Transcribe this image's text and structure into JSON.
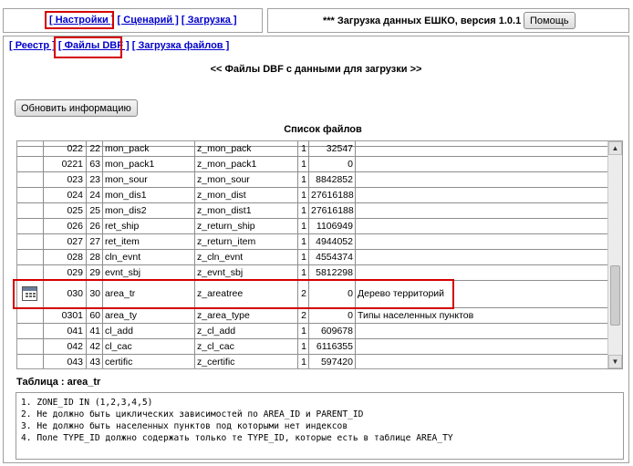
{
  "topnav": {
    "settings": "[ Настройки ]",
    "scenario": "[ Сценарий ]",
    "upload": "[ Загрузка ]"
  },
  "header": {
    "title": "*** Загрузка данных ЕШКО, версия 1.0.1 ***",
    "help_label": "Помощь"
  },
  "subtabs": {
    "registry": "[ Реестр ]",
    "dbf_files": "[ Файлы DBF ]",
    "file_upload": "[ Загрузка файлов ]"
  },
  "heading": "<< Файлы DBF с данными для загрузки >>",
  "refresh_label": "Обновить информацию",
  "list_caption": "Список файлов",
  "grid": {
    "rows": [
      {
        "code": "022",
        "num": "22",
        "file": "mon_pack",
        "table": "z_mon_pack",
        "type": "1",
        "count": "32547",
        "descr": ""
      },
      {
        "code": "0221",
        "num": "63",
        "file": "mon_pack1",
        "table": "z_mon_pack1",
        "type": "1",
        "count": "0",
        "descr": ""
      },
      {
        "code": "023",
        "num": "23",
        "file": "mon_sour",
        "table": "z_mon_sour",
        "type": "1",
        "count": "8842852",
        "descr": ""
      },
      {
        "code": "024",
        "num": "24",
        "file": "mon_dis1",
        "table": "z_mon_dist",
        "type": "1",
        "count": "27616188",
        "descr": ""
      },
      {
        "code": "025",
        "num": "25",
        "file": "mon_dis2",
        "table": "z_mon_dist1",
        "type": "1",
        "count": "27616188",
        "descr": ""
      },
      {
        "code": "026",
        "num": "26",
        "file": "ret_ship",
        "table": "z_return_ship",
        "type": "1",
        "count": "1106949",
        "descr": ""
      },
      {
        "code": "027",
        "num": "27",
        "file": "ret_item",
        "table": "z_return_item",
        "type": "1",
        "count": "4944052",
        "descr": ""
      },
      {
        "code": "028",
        "num": "28",
        "file": "cln_evnt",
        "table": "z_cln_evnt",
        "type": "1",
        "count": "4554374",
        "descr": ""
      },
      {
        "code": "029",
        "num": "29",
        "file": "evnt_sbj",
        "table": "z_evnt_sbj",
        "type": "1",
        "count": "5812298",
        "descr": ""
      },
      {
        "code": "030",
        "num": "30",
        "file": "area_tr",
        "table": "z_areatree",
        "type": "2",
        "count": "0",
        "descr": "Дерево территорий",
        "selected": true
      },
      {
        "code": "0301",
        "num": "60",
        "file": "area_ty",
        "table": "z_area_type",
        "type": "2",
        "count": "0",
        "descr": "Типы населенных пунктов"
      },
      {
        "code": "041",
        "num": "41",
        "file": "cl_add",
        "table": "z_cl_add",
        "type": "1",
        "count": "609678",
        "descr": ""
      },
      {
        "code": "042",
        "num": "42",
        "file": "cl_cac",
        "table": "z_cl_cac",
        "type": "1",
        "count": "6116355",
        "descr": ""
      },
      {
        "code": "043",
        "num": "43",
        "file": "certific",
        "table": "z_certific",
        "type": "1",
        "count": "597420",
        "descr": ""
      }
    ]
  },
  "table_label": "Таблица : area_tr",
  "conditions": [
    "1. ZONE_ID IN (1,2,3,4,5)",
    "2. Не должно быть циклических зависимостей по AREA_ID и PARENT_ID",
    "3. Не должно быть населенных пунктов под которыми нет индексов",
    "4. Поле TYPE_ID должно содержать только те TYPE_ID, которые есть в таблице AREA_TY"
  ],
  "highlight_color": "#d40000",
  "link_color": "#0000cc"
}
